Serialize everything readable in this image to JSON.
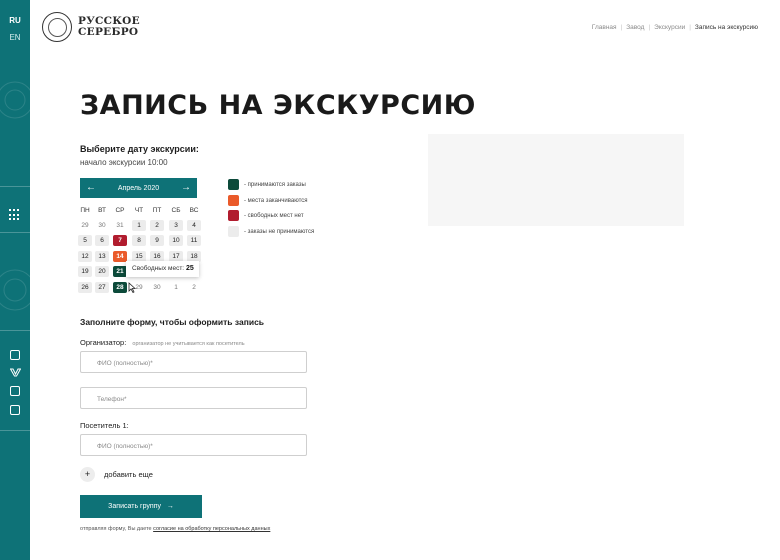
{
  "sidebar": {
    "lang_ru": "RU",
    "lang_en": "EN",
    "menu_icon": "grid-menu-icon",
    "social_icons": [
      "instagram-icon",
      "vk-icon",
      "facebook-icon",
      "youtube-icon"
    ]
  },
  "header": {
    "logo_line1": "РУССКОЕ",
    "logo_line2": "СЕРЕБРО",
    "breadcrumbs": [
      "Главная",
      "Завод",
      "Экскурсии",
      "Запись на экскурсию"
    ]
  },
  "page": {
    "title": "ЗАПИСЬ НА ЭКСКУРСИЮ",
    "choose_date": "Выберите дату экскурсии:",
    "start_time": "начало экскурсии 10:00"
  },
  "calendar": {
    "month": "Апрель 2020",
    "prev": "←",
    "next": "→",
    "weekdays": [
      "ПН",
      "ВТ",
      "СР",
      "ЧТ",
      "ПТ",
      "СБ",
      "ВС"
    ],
    "weeks": [
      [
        {
          "d": "29",
          "s": "out"
        },
        {
          "d": "30",
          "s": "out"
        },
        {
          "d": "31",
          "s": "out"
        },
        {
          "d": "1",
          "s": "none"
        },
        {
          "d": "2",
          "s": "none"
        },
        {
          "d": "3",
          "s": "none"
        },
        {
          "d": "4",
          "s": "none"
        }
      ],
      [
        {
          "d": "5",
          "s": "none"
        },
        {
          "d": "6",
          "s": "none"
        },
        {
          "d": "7",
          "s": "red"
        },
        {
          "d": "8",
          "s": "none"
        },
        {
          "d": "9",
          "s": "none"
        },
        {
          "d": "10",
          "s": "none"
        },
        {
          "d": "11",
          "s": "none"
        }
      ],
      [
        {
          "d": "12",
          "s": "none"
        },
        {
          "d": "13",
          "s": "none"
        },
        {
          "d": "14",
          "s": "orange"
        },
        {
          "d": "15",
          "s": "none"
        },
        {
          "d": "16",
          "s": "none"
        },
        {
          "d": "17",
          "s": "none"
        },
        {
          "d": "18",
          "s": "none"
        }
      ],
      [
        {
          "d": "19",
          "s": "none"
        },
        {
          "d": "20",
          "s": "none"
        },
        {
          "d": "21",
          "s": "green"
        },
        {
          "d": "",
          "s": "hidden"
        },
        {
          "d": "",
          "s": "hidden"
        },
        {
          "d": "",
          "s": "hidden"
        },
        {
          "d": "",
          "s": "hidden"
        }
      ],
      [
        {
          "d": "26",
          "s": "none"
        },
        {
          "d": "27",
          "s": "none"
        },
        {
          "d": "28",
          "s": "green"
        },
        {
          "d": "29",
          "s": "out"
        },
        {
          "d": "30",
          "s": "out"
        },
        {
          "d": "1",
          "s": "out"
        },
        {
          "d": "2",
          "s": "out"
        }
      ]
    ],
    "tooltip_label": "Свободных мест:",
    "tooltip_value": "25"
  },
  "legend": [
    {
      "color": "#0c4a3a",
      "label": "- принимаются заказы"
    },
    {
      "color": "#ea5a2a",
      "label": "- места заканчиваются"
    },
    {
      "color": "#b11c2e",
      "label": "- свободных мест нет"
    },
    {
      "color": "#ececec",
      "label": "- заказы не принимаются"
    }
  ],
  "form": {
    "title": "Заполните форму, чтобы оформить запись",
    "organizer_label": "Организатор:",
    "organizer_hint": "организатор не учитывается как посетитель",
    "organizer_name_placeholder": "ФИО (полностью)*",
    "phone_placeholder": "Телефон*",
    "visitor_label": "Посетитель 1:",
    "visitor_name_placeholder": "ФИО (полностью)*",
    "add_more": "добавить еще",
    "submit": "Записать группу",
    "submit_arrow": "→",
    "note_prefix": "отправляя форму, Вы даете",
    "note_link": "согласие на обработку персональных данных"
  }
}
